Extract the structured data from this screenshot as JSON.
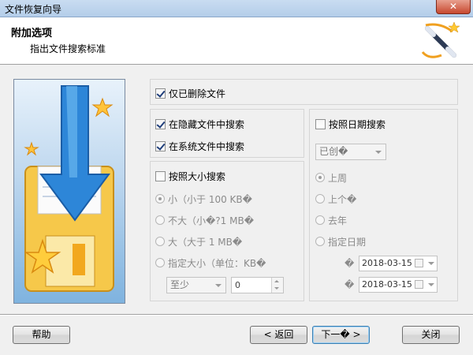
{
  "window": {
    "title": "文件恢复向导",
    "close_label": "✕"
  },
  "header": {
    "title": "附加选项",
    "subtitle": "指出文件搜索标准",
    "wand_icon": "magic-wand-icon"
  },
  "options": {
    "deleted_only": {
      "label": "仅已删除文件",
      "checked": true
    },
    "hidden": {
      "label": "在隐藏文件中搜索",
      "checked": true
    },
    "system": {
      "label": "在系统文件中搜索",
      "checked": true
    }
  },
  "size": {
    "label": "按照大小搜索",
    "checked": false,
    "choices": [
      {
        "label": "小（小于 100 KB�",
        "selected": true
      },
      {
        "label": "不大（小�?1 MB�",
        "selected": false
      },
      {
        "label": "大（大于 1 MB�",
        "selected": false
      },
      {
        "label": "指定大小（单位：KB�",
        "selected": false
      }
    ],
    "mode_value": "至少",
    "amount_value": "0"
  },
  "date": {
    "label": "按照日期搜索",
    "checked": false,
    "kind_value": "已创�",
    "choices": [
      {
        "label": "上周",
        "selected": true
      },
      {
        "label": "上个�",
        "selected": false
      },
      {
        "label": "去年",
        "selected": false
      },
      {
        "label": "指定日期",
        "selected": false
      }
    ],
    "from_marker": "�",
    "from_value": "2018-03-15",
    "to_marker": "�",
    "to_value": "2018-03-15"
  },
  "buttons": {
    "help": "帮助",
    "back": "< 返回",
    "next": "下一� >",
    "close": "关闭"
  }
}
